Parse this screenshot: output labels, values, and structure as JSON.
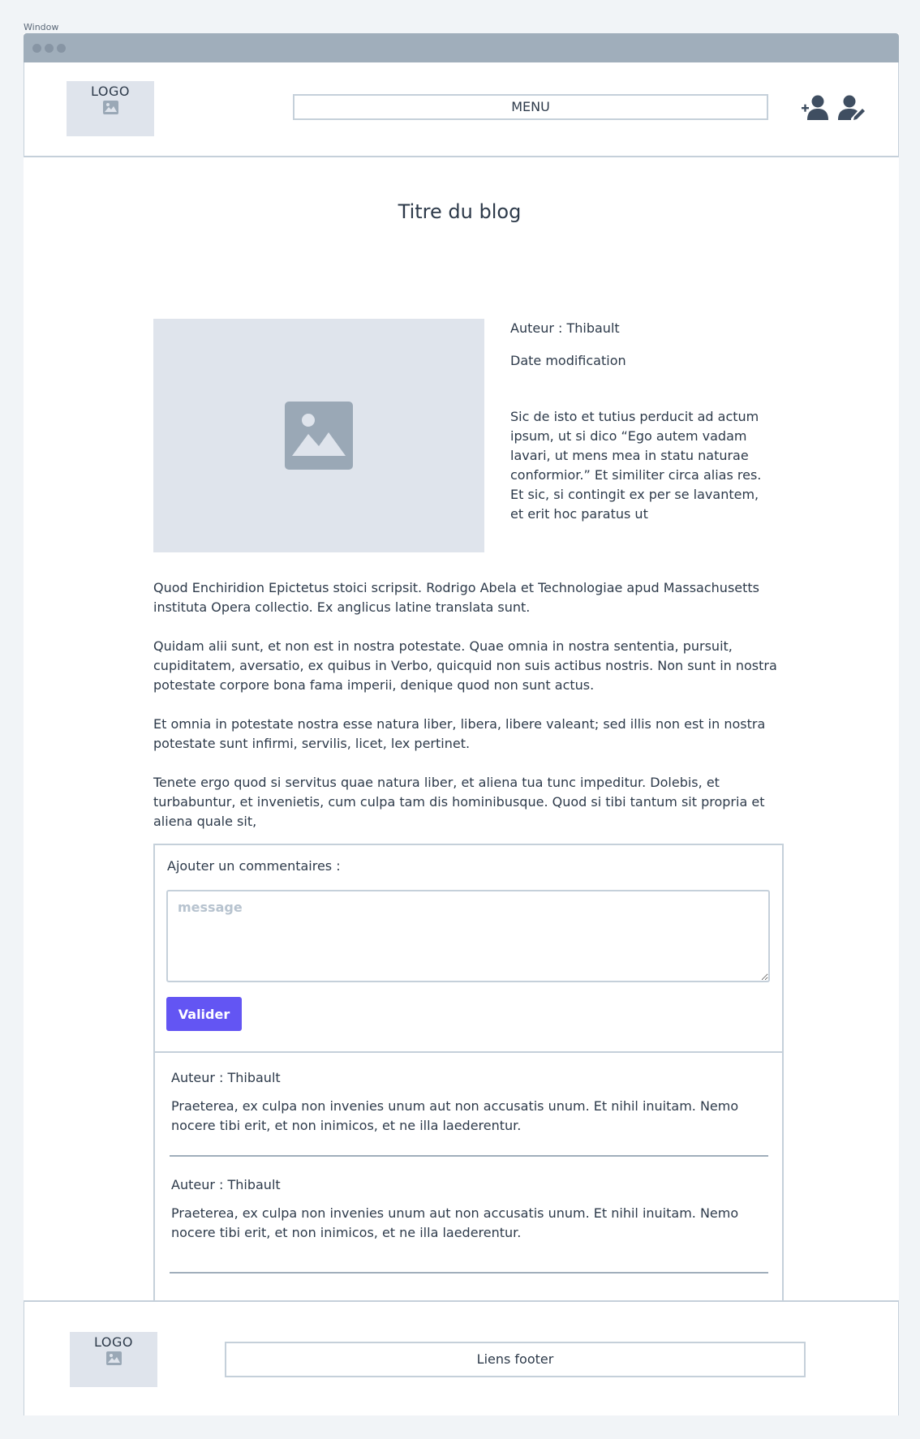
{
  "window": {
    "label": "Window"
  },
  "header": {
    "logo": "LOGO",
    "menu": "MENU",
    "icons": [
      "add-user-icon",
      "edit-user-icon"
    ]
  },
  "blog": {
    "title": "Titre du blog",
    "author": "Auteur : Thibault",
    "date": "Date modification",
    "intro": "Sic de isto et tutius perducit ad actum ipsum, ut si dico “Ego autem vadam lavari, ut mens mea in statu naturae conformior.” Et similiter circa alias res. Et sic, si contingit ex per se lavantem, et erit hoc paratus ut",
    "paragraphs": [
      "Quod Enchiridion Epictetus stoici scripsit. Rodrigo Abela et Technologiae apud Massachusetts instituta Opera collectio. Ex anglicus latine translata sunt.",
      "Quidam alii sunt, et non est in nostra potestate. Quae omnia in nostra sententia, pursuit, cupiditatem, aversatio, ex quibus in Verbo, quicquid non suis actibus nostris. Non sunt in nostra potestate corpore bona fama imperii, denique quod non sunt actus.",
      "Et omnia in potestate nostra esse natura liber, libera, libere valeant; sed illis non est in nostra potestate sunt infirmi, servilis, licet, lex pertinet.",
      "Tenete ergo quod si servitus quae natura liber, et aliena tua tunc impeditur. Dolebis, et turbabuntur, et invenietis, cum culpa tam dis hominibusque. Quod si tibi tantum sit propria et aliena quale sit,"
    ]
  },
  "comments": {
    "label": "Ajouter un commentaires :",
    "placeholder": "message",
    "submit": "Valider",
    "items": [
      {
        "author": "Auteur : Thibault",
        "text": "Praeterea, ex culpa non invenies unum aut non accusatis unum. Et nihil inuitam. Nemo nocere tibi erit, et non inimicos, et ne illa laederentur."
      },
      {
        "author": "Auteur : Thibault",
        "text": "Praeterea, ex culpa non invenies unum aut non accusatis unum. Et nihil inuitam. Nemo nocere tibi erit, et non inimicos, et ne illa laederentur."
      }
    ]
  },
  "footer": {
    "logo": "LOGO",
    "links": "Liens footer"
  },
  "colors": {
    "accent": "#6355f3",
    "placeholder_bg": "#dfe4ec",
    "border": "#c5d0da",
    "text": "#2d3a4a"
  }
}
